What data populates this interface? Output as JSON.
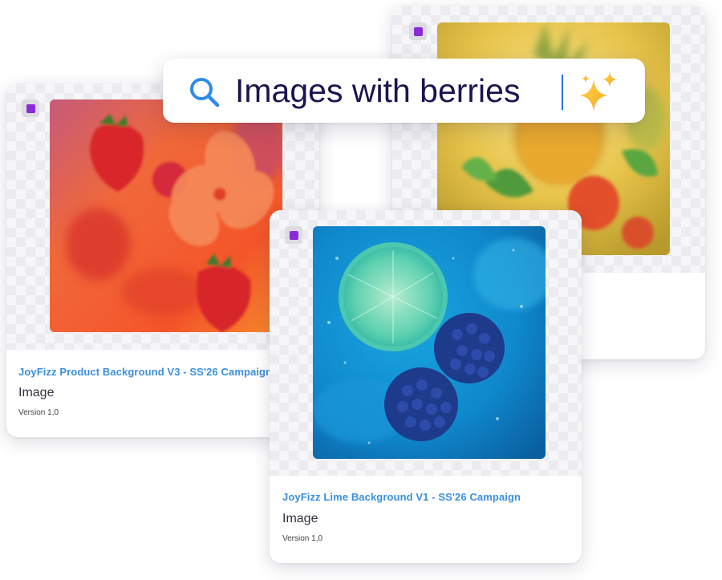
{
  "search": {
    "query": "Images with berries",
    "icon": "search-icon",
    "ai_icon": "sparkle-icon",
    "accent": "#2f8be6",
    "text_color": "#1c1350"
  },
  "cards": [
    {
      "title": "JoyFizz Product Background V3 - SS'26 Campaign",
      "kind": "Image",
      "version": "Version 1,0"
    },
    {
      "title": "",
      "kind": "",
      "version": ""
    },
    {
      "title": "JoyFizz Lime Background V1 - SS'26 Campaign",
      "kind": "Image",
      "version": "Version 1,0"
    }
  ],
  "colors": {
    "title_link": "#3a8fe0",
    "checkbox": "#8b2bd8"
  }
}
